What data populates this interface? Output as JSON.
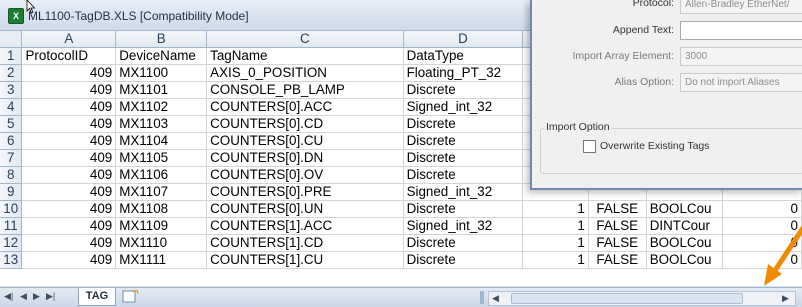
{
  "window": {
    "title": "ML1100-TagDB.XLS  [Compatibility Mode]",
    "app_icon": "excel-icon"
  },
  "grid": {
    "columns": [
      "A",
      "B",
      "C",
      "D"
    ],
    "rows": [
      {
        "n": "1",
        "a": "ProtocolID",
        "b": "DeviceName",
        "c": "TagName",
        "d": "DataType",
        "e": "",
        "f": "",
        "g": "",
        "h": ""
      },
      {
        "n": "2",
        "a": "409",
        "b": "MX1100",
        "c": "AXIS_0_POSITION",
        "d": "Floating_PT_32",
        "e": "",
        "f": "",
        "g": "",
        "h": ""
      },
      {
        "n": "3",
        "a": "409",
        "b": "MX1101",
        "c": "CONSOLE_PB_LAMP",
        "d": "Discrete",
        "e": "",
        "f": "",
        "g": "",
        "h": ""
      },
      {
        "n": "4",
        "a": "409",
        "b": "MX1102",
        "c": "COUNTERS[0].ACC",
        "d": "Signed_int_32",
        "e": "",
        "f": "",
        "g": "",
        "h": ""
      },
      {
        "n": "5",
        "a": "409",
        "b": "MX1103",
        "c": "COUNTERS[0].CD",
        "d": "Discrete",
        "e": "",
        "f": "",
        "g": "",
        "h": ""
      },
      {
        "n": "6",
        "a": "409",
        "b": "MX1104",
        "c": "COUNTERS[0].CU",
        "d": "Discrete",
        "e": "",
        "f": "",
        "g": "",
        "h": ""
      },
      {
        "n": "7",
        "a": "409",
        "b": "MX1105",
        "c": "COUNTERS[0].DN",
        "d": "Discrete",
        "e": "",
        "f": "",
        "g": "",
        "h": ""
      },
      {
        "n": "8",
        "a": "409",
        "b": "MX1106",
        "c": "COUNTERS[0].OV",
        "d": "Discrete",
        "e": "",
        "f": "",
        "g": "",
        "h": ""
      },
      {
        "n": "9",
        "a": "409",
        "b": "MX1107",
        "c": "COUNTERS[0].PRE",
        "d": "Signed_int_32",
        "e": "",
        "f": "",
        "g": "",
        "h": ""
      },
      {
        "n": "10",
        "a": "409",
        "b": "MX1108",
        "c": "COUNTERS[0].UN",
        "d": "Discrete",
        "e": "1",
        "f": "FALSE",
        "g": "BOOLCou",
        "h": "0"
      },
      {
        "n": "11",
        "a": "409",
        "b": "MX1109",
        "c": "COUNTERS[1].ACC",
        "d": "Signed_int_32",
        "e": "1",
        "f": "FALSE",
        "g": "DINTCour",
        "h": "0"
      },
      {
        "n": "12",
        "a": "409",
        "b": "MX1110",
        "c": "COUNTERS[1].CD",
        "d": "Discrete",
        "e": "1",
        "f": "FALSE",
        "g": "BOOLCou",
        "h": "0"
      },
      {
        "n": "13",
        "a": "409",
        "b": "MX1111",
        "c": "COUNTERS[1].CU",
        "d": "Discrete",
        "e": "1",
        "f": "FALSE",
        "g": "BOOLCou",
        "h": "0"
      }
    ]
  },
  "sheet_tabs": {
    "active": "TAG"
  },
  "dialog": {
    "protocol_label": "Protocol:",
    "protocol_value": "Allen-Bradley EtherNet/",
    "append_text_label": "Append Text:",
    "append_text_value": "",
    "import_array_label": "Import Array Element:",
    "import_array_value": "3000",
    "alias_option_label": "Alias Option:",
    "alias_option_value": "Do not import Aliases",
    "import_option_title": "Import Option",
    "overwrite_label": "Overwrite Existing Tags",
    "overwrite_checked": false
  },
  "colors": {
    "annotation_arrow": "#f08a00",
    "title_bar": "#dbe5f1"
  }
}
